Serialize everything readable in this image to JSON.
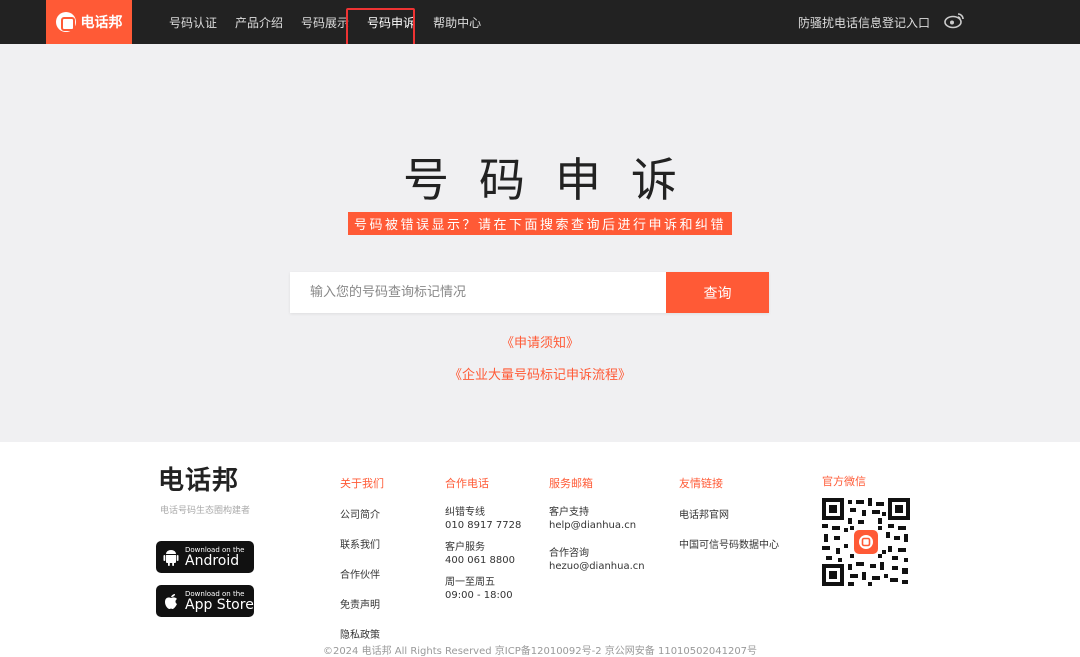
{
  "brand": {
    "logo_text": "电话邦",
    "accent": "#ff5a36"
  },
  "nav": {
    "items": [
      {
        "label": "号码认证"
      },
      {
        "label": "产品介绍"
      },
      {
        "label": "号码展示"
      },
      {
        "label": "号码申诉",
        "active": true
      },
      {
        "label": "帮助中心"
      }
    ],
    "right_link": "防骚扰电话信息登记入口",
    "weibo_icon": "weibo-icon"
  },
  "hero": {
    "title": "号码申诉",
    "subtitle": "号码被错误显示？请在下面搜索查询后进行申诉和纠错",
    "search_placeholder": "输入您的号码查询标记情况",
    "search_button": "查询",
    "link_notice": "《申请须知》",
    "link_enterprise": "《企业大量号码标记申诉流程》"
  },
  "footer": {
    "brand": "电话邦",
    "slogan": "电话号码生态圈构建者",
    "android": {
      "small": "Download on the",
      "large": "Android"
    },
    "appstore": {
      "small": "Download on the",
      "large": "App Store"
    },
    "about": {
      "title": "关于我们",
      "items": [
        "公司简介",
        "联系我们",
        "合作伙伴",
        "免责声明",
        "隐私政策"
      ]
    },
    "phone": {
      "title": "合作电话",
      "groups": [
        {
          "label": "纠错专线",
          "value": "010 8917 7728"
        },
        {
          "label": "客户服务",
          "value": "400 061 8800"
        },
        {
          "label": "周一至周五",
          "value": "09:00 - 18:00"
        }
      ]
    },
    "email": {
      "title": "服务邮箱",
      "groups": [
        {
          "label": "客户支持",
          "value": "help@dianhua.cn"
        },
        {
          "label": "合作咨询",
          "value": "hezuo@dianhua.cn"
        }
      ]
    },
    "links": {
      "title": "友情链接",
      "items": [
        "电话邦官网",
        "中国可信号码数据中心"
      ]
    },
    "wechat": {
      "title": "官方微信"
    },
    "copyright": "©2024 电话邦 All Rights Reserved 京ICP备12010092号-2 京公网安备 11010502041207号"
  }
}
